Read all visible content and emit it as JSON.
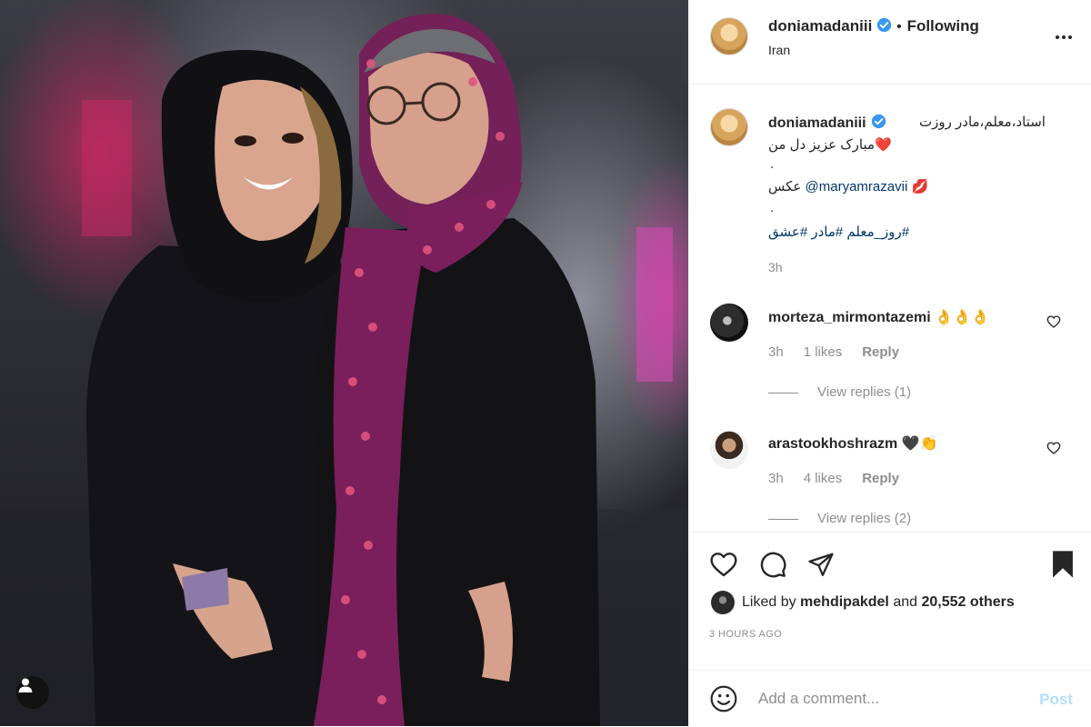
{
  "header": {
    "username": "doniamadaniii",
    "separator": "•",
    "follow_state": "Following",
    "location": "Iran"
  },
  "caption": {
    "username": "doniamadaniii",
    "line1": "استاد،معلم،مادر روزت",
    "line2": "مبارک عزیز دل من❤️",
    "dot1": ".",
    "line3_prefix": "عکس",
    "mention": "@maryamrazavii",
    "line3_emoji": "💋",
    "dot2": ".",
    "hashtags": "روز_معلم #مادر #عشق#",
    "time": "3h"
  },
  "comments": [
    {
      "username": "morteza_mirmontazemi",
      "text": "👌👌👌",
      "time": "3h",
      "likes": "1 likes",
      "reply": "Reply",
      "view_replies": "View replies (1)"
    },
    {
      "username": "arastookhoshrazm",
      "text": "🖤👏",
      "time": "3h",
      "likes": "4 likes",
      "reply": "Reply",
      "view_replies": "View replies (2)"
    }
  ],
  "likes": {
    "prefix": "Liked by",
    "user": "mehdipakdel",
    "middle": "and",
    "count": "20,552 others"
  },
  "posted": "3 HOURS AGO",
  "add_comment": {
    "placeholder": "Add a comment...",
    "post_label": "Post"
  },
  "colors": {
    "link": "#00376b",
    "verified": "#3897f0",
    "muted": "#8e8e8e",
    "post_disabled": "#b2dffc",
    "scarf": "#7a1f5c"
  },
  "icons": [
    "verified-badge-icon",
    "more-options-icon",
    "heart-icon",
    "comment-icon",
    "share-icon",
    "bookmark-icon",
    "emoji-icon",
    "user-tag-icon"
  ]
}
